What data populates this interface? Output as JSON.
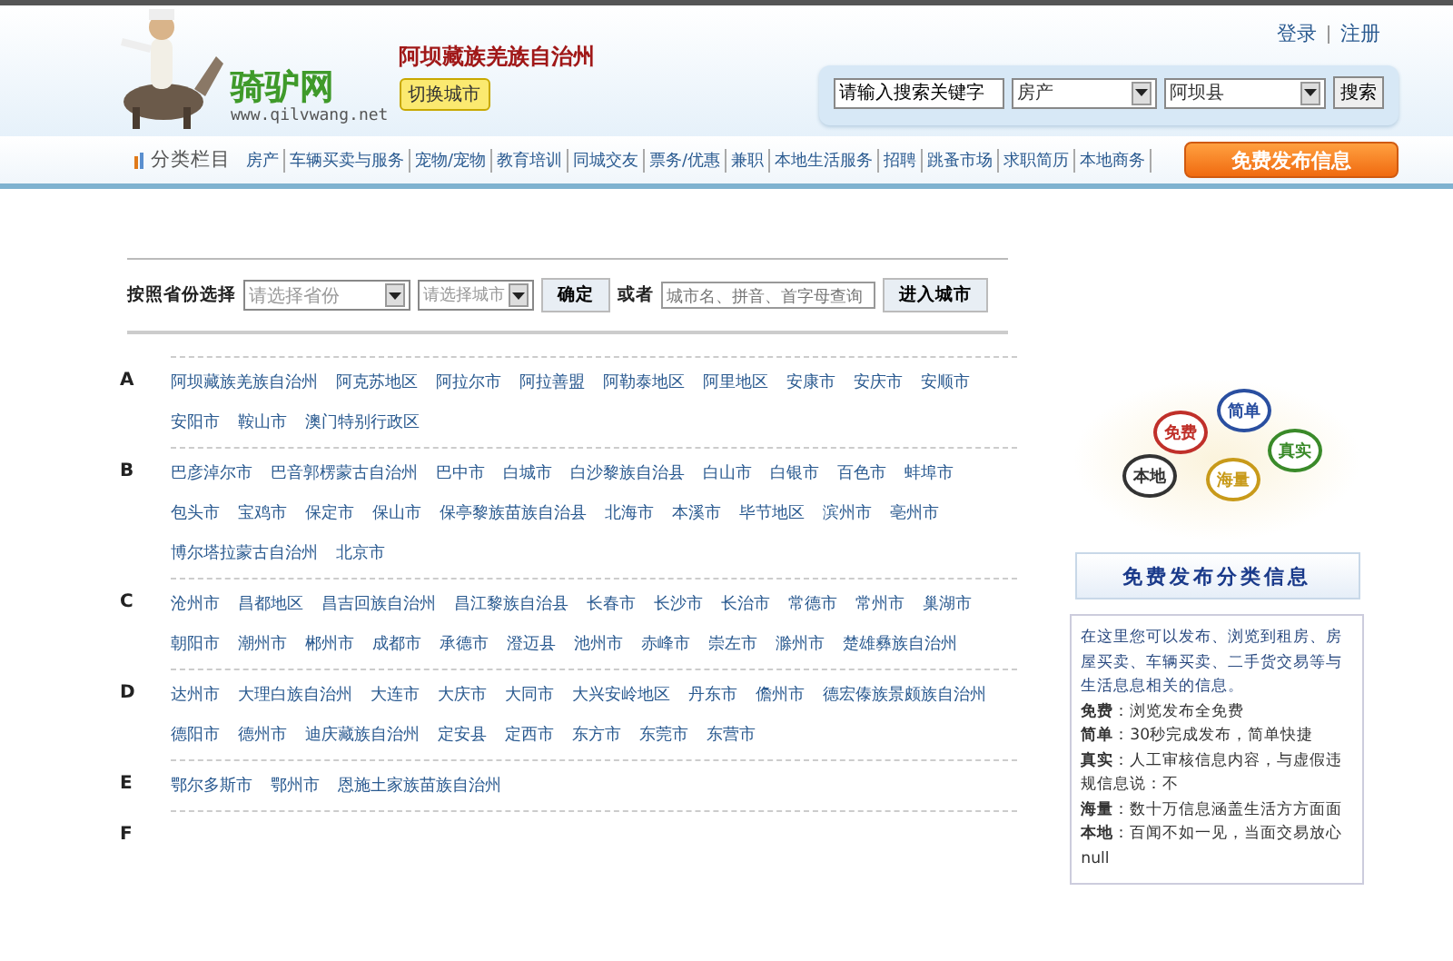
{
  "header": {
    "site_name": "骑驴网",
    "site_url": "www.qilvwang.net",
    "city_name": "阿坝藏族羌族自治州",
    "switch_city_button": "切换城市",
    "account_links": [
      "登录",
      "注册"
    ],
    "search": {
      "keyword": "请输入搜索关键字",
      "category": "房产",
      "county": "阿坝县",
      "button": "搜索"
    }
  },
  "nav": {
    "label": "分类栏目",
    "items": [
      "房产",
      "车辆买卖与服务",
      "宠物/宠物",
      "教育培训",
      "同城交友",
      "票务/优惠",
      "兼职",
      "本地生活服务",
      "招聘",
      "跳蚤市场",
      "求职简历",
      "本地商务"
    ],
    "publish_button": "免费发布信息"
  },
  "city_picker": {
    "label": "按照省份选择",
    "province_placeholder": "请选择省份",
    "city_placeholder": "请选择城市",
    "confirm_button": "确定",
    "or_label": "或者",
    "search_placeholder": "城市名、拼音、首字母查询",
    "enter_button": "进入城市"
  },
  "groups": [
    {
      "letter": "A",
      "cities": [
        "阿坝藏族羌族自治州",
        "阿克苏地区",
        "阿拉尔市",
        "阿拉善盟",
        "阿勒泰地区",
        "阿里地区",
        "安康市",
        "安庆市",
        "安顺市",
        "安阳市",
        "鞍山市",
        "澳门特别行政区"
      ]
    },
    {
      "letter": "B",
      "cities": [
        "巴彦淖尔市",
        "巴音郭楞蒙古自治州",
        "巴中市",
        "白城市",
        "白沙黎族自治县",
        "白山市",
        "白银市",
        "百色市",
        "蚌埠市",
        "包头市",
        "宝鸡市",
        "保定市",
        "保山市",
        "保亭黎族苗族自治县",
        "北海市",
        "本溪市",
        "毕节地区",
        "滨州市",
        "亳州市",
        "博尔塔拉蒙古自治州",
        "北京市"
      ]
    },
    {
      "letter": "C",
      "cities": [
        "沧州市",
        "昌都地区",
        "昌吉回族自治州",
        "昌江黎族自治县",
        "长春市",
        "长沙市",
        "长治市",
        "常德市",
        "常州市",
        "巢湖市",
        "朝阳市",
        "潮州市",
        "郴州市",
        "成都市",
        "承德市",
        "澄迈县",
        "池州市",
        "赤峰市",
        "崇左市",
        "滁州市",
        "楚雄彝族自治州"
      ]
    },
    {
      "letter": "D",
      "cities": [
        "达州市",
        "大理白族自治州",
        "大连市",
        "大庆市",
        "大同市",
        "大兴安岭地区",
        "丹东市",
        "儋州市",
        "德宏傣族景颇族自治州",
        "德阳市",
        "德州市",
        "迪庆藏族自治州",
        "定安县",
        "定西市",
        "东方市",
        "东莞市",
        "东营市"
      ]
    },
    {
      "letter": "E",
      "cities": [
        "鄂尔多斯市",
        "鄂州市",
        "恩施土家族苗族自治州"
      ]
    },
    {
      "letter": "F"
    }
  ],
  "sidebar": {
    "bubbles": [
      "免费",
      "简单",
      "本地",
      "海量",
      "真实"
    ],
    "title": "免费发布分类信息",
    "intro": "在这里您可以发布、浏览到租房、房屋买卖、车辆买卖、二手货交易等与生活息息相关的信息。",
    "features": [
      "**免费**：浏览发布全免费",
      "**简单**：30秒完成发布，简单快捷",
      "**真实**：人工审核信息内容，与虚假违规信息说：不",
      "**海量**：数十万信息涵盖生活方方面面",
      "**本地**：百闻不如一见，当面交易放心"
    ],
    "footer": "null"
  }
}
